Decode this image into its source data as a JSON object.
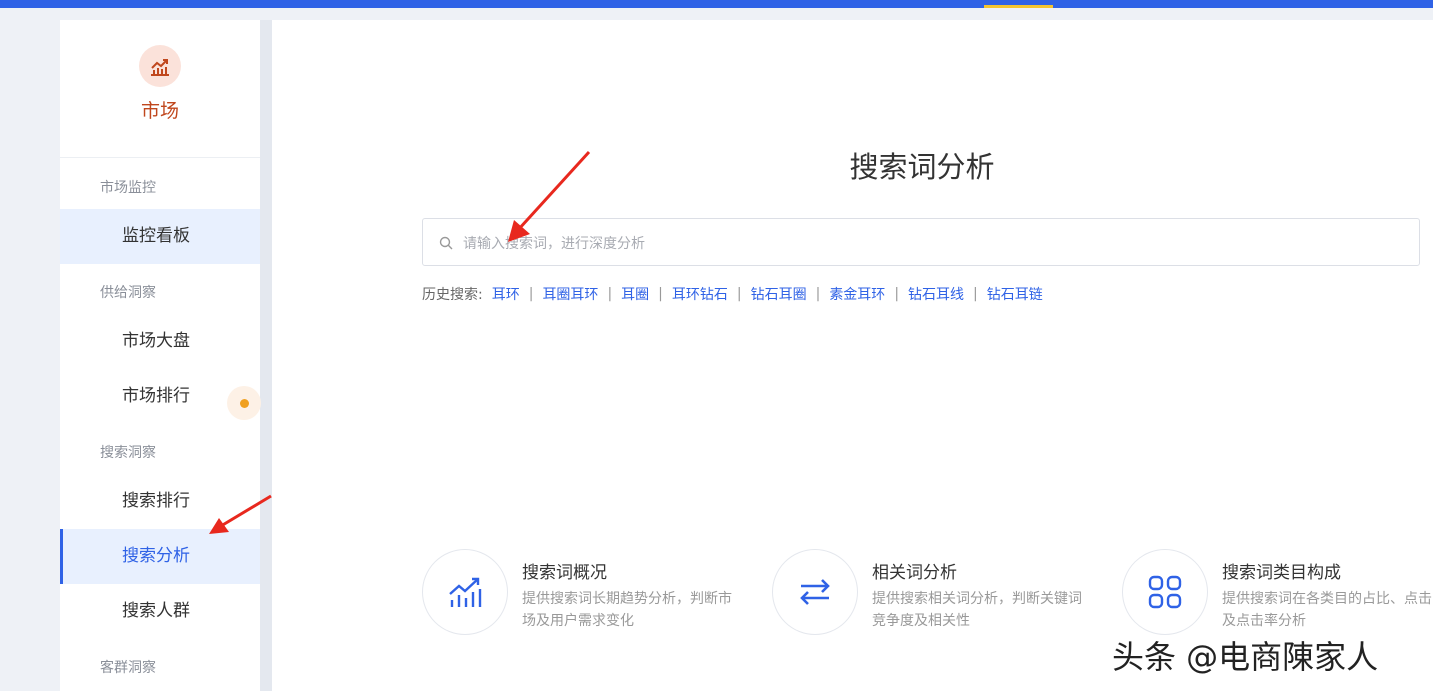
{
  "sidebar": {
    "module_title": "市场",
    "groups": [
      {
        "label": "市场监控"
      },
      {
        "label": "供给洞察"
      },
      {
        "label": "搜索洞察"
      },
      {
        "label": "客群洞察"
      }
    ],
    "items": [
      {
        "label": "监控看板"
      },
      {
        "label": "市场大盘"
      },
      {
        "label": "市场排行"
      },
      {
        "label": "搜索排行"
      },
      {
        "label": "搜索分析"
      },
      {
        "label": "搜索人群"
      }
    ],
    "active_item": "搜索分析"
  },
  "main": {
    "title": "搜索词分析",
    "search": {
      "placeholder": "请输入搜索词，进行深度分析",
      "value": ""
    },
    "history_label": "历史搜索:",
    "history": [
      "耳环",
      "耳圈耳环",
      "耳圈",
      "耳环钻石",
      "钻石耳圈",
      "素金耳环",
      "钻石耳线",
      "钻石耳链"
    ],
    "features": [
      {
        "title": "搜索词概况",
        "desc": "提供搜索词长期趋势分析，判断市场及用户需求变化",
        "icon": "trend-chart-icon"
      },
      {
        "title": "相关词分析",
        "desc": "提供搜索相关词分析，判断关键词竞争度及相关性",
        "icon": "swap-arrows-icon"
      },
      {
        "title": "搜索词类目构成",
        "desc": "提供搜索词在各类目的占比、点击及点击率分析",
        "icon": "grid-icon"
      }
    ]
  },
  "watermark": "头条 @电商陳家人",
  "colors": {
    "primary": "#2f62e6",
    "module": "#c0471d",
    "accent": "#f4c430",
    "dot": "#f0a020",
    "annotation_arrow": "#e8281e"
  }
}
